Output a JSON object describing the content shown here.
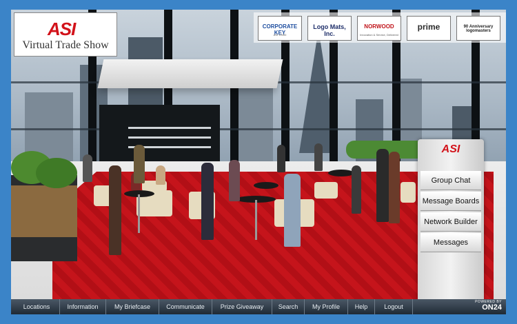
{
  "brand": {
    "mark": "ASI",
    "title": "Virtual Trade Show"
  },
  "sponsors": [
    {
      "name": "CORPORATE KEY",
      "sub": "ASI 12000"
    },
    {
      "name": "Logo Mats, Inc.",
      "sub": ""
    },
    {
      "name": "NORWOOD",
      "sub": "Innovation & Service, Delivered"
    },
    {
      "name": "prime",
      "sub": ""
    },
    {
      "name": "90 Anniversary logomasters",
      "sub": ""
    }
  ],
  "side_menu": {
    "mark": "ASI",
    "items": [
      "Group Chat",
      "Message Boards",
      "Network Builder",
      "Messages"
    ]
  },
  "nav": {
    "items": [
      "Locations",
      "Information",
      "My Briefcase",
      "Communicate",
      "Prize Giveaway",
      "Search",
      "My Profile",
      "Help",
      "Logout"
    ],
    "powered_by": "POWERED BY",
    "powered_brand": "ON24"
  },
  "colors": {
    "frame_blue": "#3b84c8",
    "brand_red": "#d2121a",
    "carpet_red": "#c5141b",
    "nav_dark": "#1f2a35"
  }
}
